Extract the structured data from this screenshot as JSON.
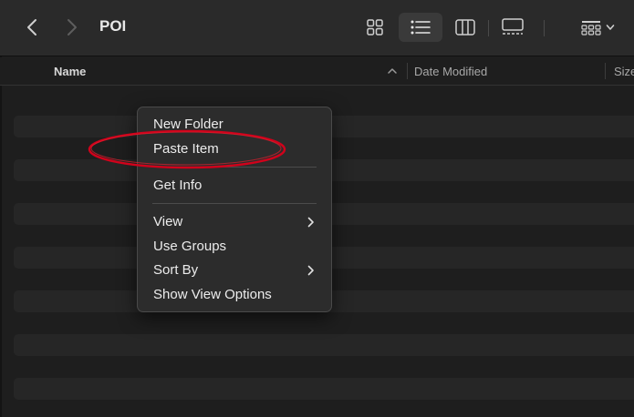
{
  "toolbar": {
    "folder_title": "POI",
    "back_icon": "chevron-left-icon",
    "forward_icon": "chevron-right-icon",
    "view_modes": [
      "icon-view-icon",
      "list-view-icon",
      "column-view-icon",
      "gallery-view-icon"
    ],
    "selected_view": "list",
    "group_icon": "group-by-icon"
  },
  "columns": {
    "name": "Name",
    "date_modified": "Date Modified",
    "size": "Size"
  },
  "context_menu": {
    "items": [
      {
        "label": "New Folder"
      },
      {
        "label": "Paste Item"
      },
      {
        "label": "Get Info"
      },
      {
        "label": "View",
        "submenu": true
      },
      {
        "label": "Use Groups"
      },
      {
        "label": "Sort By",
        "submenu": true
      },
      {
        "label": "Show View Options"
      }
    ]
  },
  "colors": {
    "background": "#1e1e1e",
    "toolbar": "#2a2a2a",
    "menu_bg": "#2c2c2c",
    "annotation": "#d0021b"
  }
}
